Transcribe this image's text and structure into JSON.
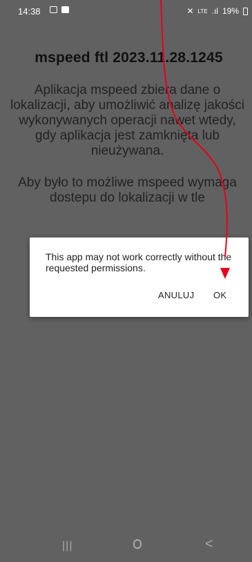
{
  "status_bar": {
    "time": "14:38",
    "signal_text": "LTE",
    "battery": "19%"
  },
  "app": {
    "title": "mspeed ftl 2023.11.28.1245",
    "paragraph1": "Aplikacja mspeed zbiera dane o lokalizacji, aby umożliwić analizę jakości wykonywanych operacji nawet wtedy, gdy aplikacja jest zamknięta lub nieużywana.",
    "paragraph2": "Aby było to możliwe mspeed wymaga dostepu do lokalizacji w tle"
  },
  "dialog": {
    "message": "This app may not work correctly without the requested permissions.",
    "cancel_label": "ANULUJ",
    "ok_label": "OK"
  },
  "nav_bar": {
    "recent_label": "|||",
    "back_label": "<"
  },
  "annotation": {
    "color": "#e8001c"
  }
}
